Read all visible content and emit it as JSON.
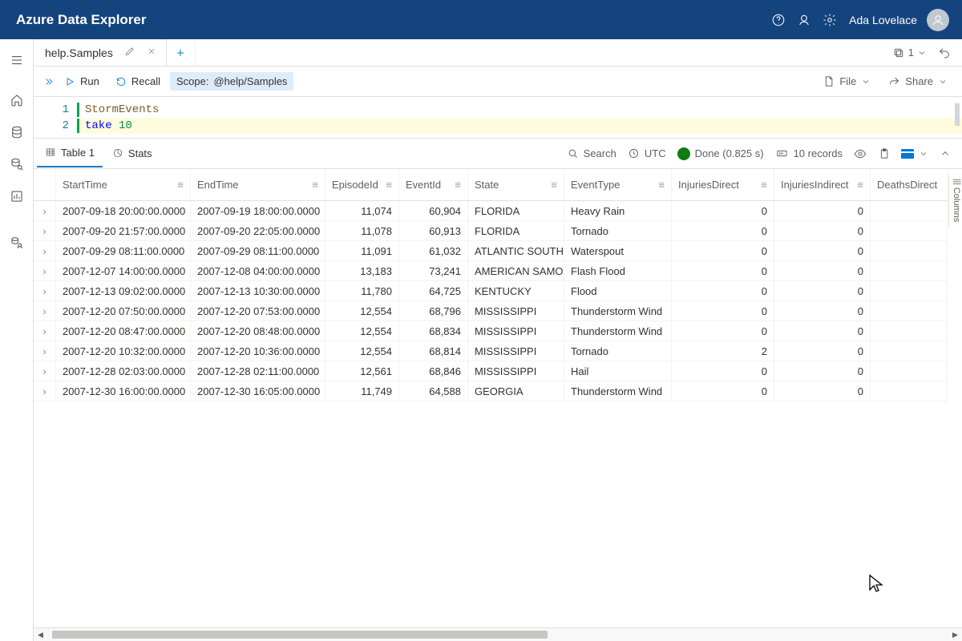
{
  "app": {
    "title": "Azure Data Explorer",
    "user": "Ada Lovelace"
  },
  "tab": {
    "label": "help.Samples",
    "counter": "1"
  },
  "toolbar": {
    "run": "Run",
    "recall": "Recall",
    "scope_label": "Scope: ",
    "scope_value": "@help/Samples",
    "file": "File",
    "share": "Share"
  },
  "editor": {
    "gutter": [
      "1",
      "2"
    ],
    "line1": "StormEvents",
    "line2_kw": "take",
    "line2_num": "10"
  },
  "results": {
    "tab_table": "Table 1",
    "tab_stats": "Stats",
    "search": "Search",
    "tz": "UTC",
    "status": "Done (0.825 s)",
    "records": "10 records",
    "side_label": "Columns"
  },
  "columns": [
    "StartTime",
    "EndTime",
    "EpisodeId",
    "EventId",
    "State",
    "EventType",
    "InjuriesDirect",
    "InjuriesIndirect",
    "DeathsDirect"
  ],
  "rows": [
    {
      "StartTime": "2007-09-18 20:00:00.0000",
      "EndTime": "2007-09-19 18:00:00.0000",
      "EpisodeId": "11,074",
      "EventId": "60,904",
      "State": "FLORIDA",
      "EventType": "Heavy Rain",
      "InjuriesDirect": "0",
      "InjuriesIndirect": "0"
    },
    {
      "StartTime": "2007-09-20 21:57:00.0000",
      "EndTime": "2007-09-20 22:05:00.0000",
      "EpisodeId": "11,078",
      "EventId": "60,913",
      "State": "FLORIDA",
      "EventType": "Tornado",
      "InjuriesDirect": "0",
      "InjuriesIndirect": "0"
    },
    {
      "StartTime": "2007-09-29 08:11:00.0000",
      "EndTime": "2007-09-29 08:11:00.0000",
      "EpisodeId": "11,091",
      "EventId": "61,032",
      "State": "ATLANTIC SOUTH",
      "EventType": "Waterspout",
      "InjuriesDirect": "0",
      "InjuriesIndirect": "0"
    },
    {
      "StartTime": "2007-12-07 14:00:00.0000",
      "EndTime": "2007-12-08 04:00:00.0000",
      "EpisodeId": "13,183",
      "EventId": "73,241",
      "State": "AMERICAN SAMOA",
      "EventType": "Flash Flood",
      "InjuriesDirect": "0",
      "InjuriesIndirect": "0"
    },
    {
      "StartTime": "2007-12-13 09:02:00.0000",
      "EndTime": "2007-12-13 10:30:00.0000",
      "EpisodeId": "11,780",
      "EventId": "64,725",
      "State": "KENTUCKY",
      "EventType": "Flood",
      "InjuriesDirect": "0",
      "InjuriesIndirect": "0"
    },
    {
      "StartTime": "2007-12-20 07:50:00.0000",
      "EndTime": "2007-12-20 07:53:00.0000",
      "EpisodeId": "12,554",
      "EventId": "68,796",
      "State": "MISSISSIPPI",
      "EventType": "Thunderstorm Wind",
      "InjuriesDirect": "0",
      "InjuriesIndirect": "0"
    },
    {
      "StartTime": "2007-12-20 08:47:00.0000",
      "EndTime": "2007-12-20 08:48:00.0000",
      "EpisodeId": "12,554",
      "EventId": "68,834",
      "State": "MISSISSIPPI",
      "EventType": "Thunderstorm Wind",
      "InjuriesDirect": "0",
      "InjuriesIndirect": "0"
    },
    {
      "StartTime": "2007-12-20 10:32:00.0000",
      "EndTime": "2007-12-20 10:36:00.0000",
      "EpisodeId": "12,554",
      "EventId": "68,814",
      "State": "MISSISSIPPI",
      "EventType": "Tornado",
      "InjuriesDirect": "2",
      "InjuriesIndirect": "0"
    },
    {
      "StartTime": "2007-12-28 02:03:00.0000",
      "EndTime": "2007-12-28 02:11:00.0000",
      "EpisodeId": "12,561",
      "EventId": "68,846",
      "State": "MISSISSIPPI",
      "EventType": "Hail",
      "InjuriesDirect": "0",
      "InjuriesIndirect": "0"
    },
    {
      "StartTime": "2007-12-30 16:00:00.0000",
      "EndTime": "2007-12-30 16:05:00.0000",
      "EpisodeId": "11,749",
      "EventId": "64,588",
      "State": "GEORGIA",
      "EventType": "Thunderstorm Wind",
      "InjuriesDirect": "0",
      "InjuriesIndirect": "0"
    }
  ]
}
